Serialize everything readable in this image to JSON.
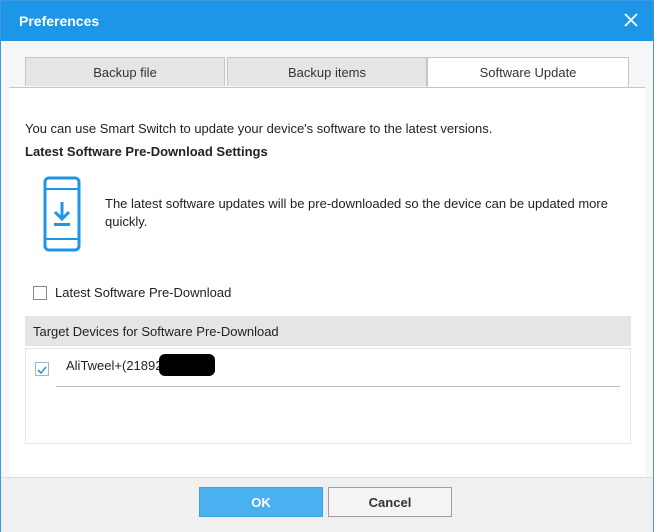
{
  "window": {
    "title": "Preferences"
  },
  "tabs": [
    {
      "label": "Backup file"
    },
    {
      "label": "Backup items"
    },
    {
      "label": "Software Update",
      "active": true
    }
  ],
  "content": {
    "description": "You can use Smart Switch to update your device's software to the latest versions.",
    "heading": "Latest Software Pre-Download Settings",
    "info": "The latest software updates will be pre-downloaded so the device can be updated more quickly.",
    "checkbox": {
      "label": "Latest Software Pre-Download",
      "checked": false
    },
    "target_header": "Target Devices for Software Pre-Download",
    "devices": [
      {
        "name": "AliTweel+(21892",
        "checked": true
      }
    ]
  },
  "buttons": {
    "ok": "OK",
    "cancel": "Cancel"
  },
  "icons": {
    "close": "close-icon",
    "phone": "phone-download-icon",
    "check": "checkmark-icon"
  },
  "colors": {
    "accent": "#1e96e8",
    "ok_button": "#4ab1f1"
  }
}
